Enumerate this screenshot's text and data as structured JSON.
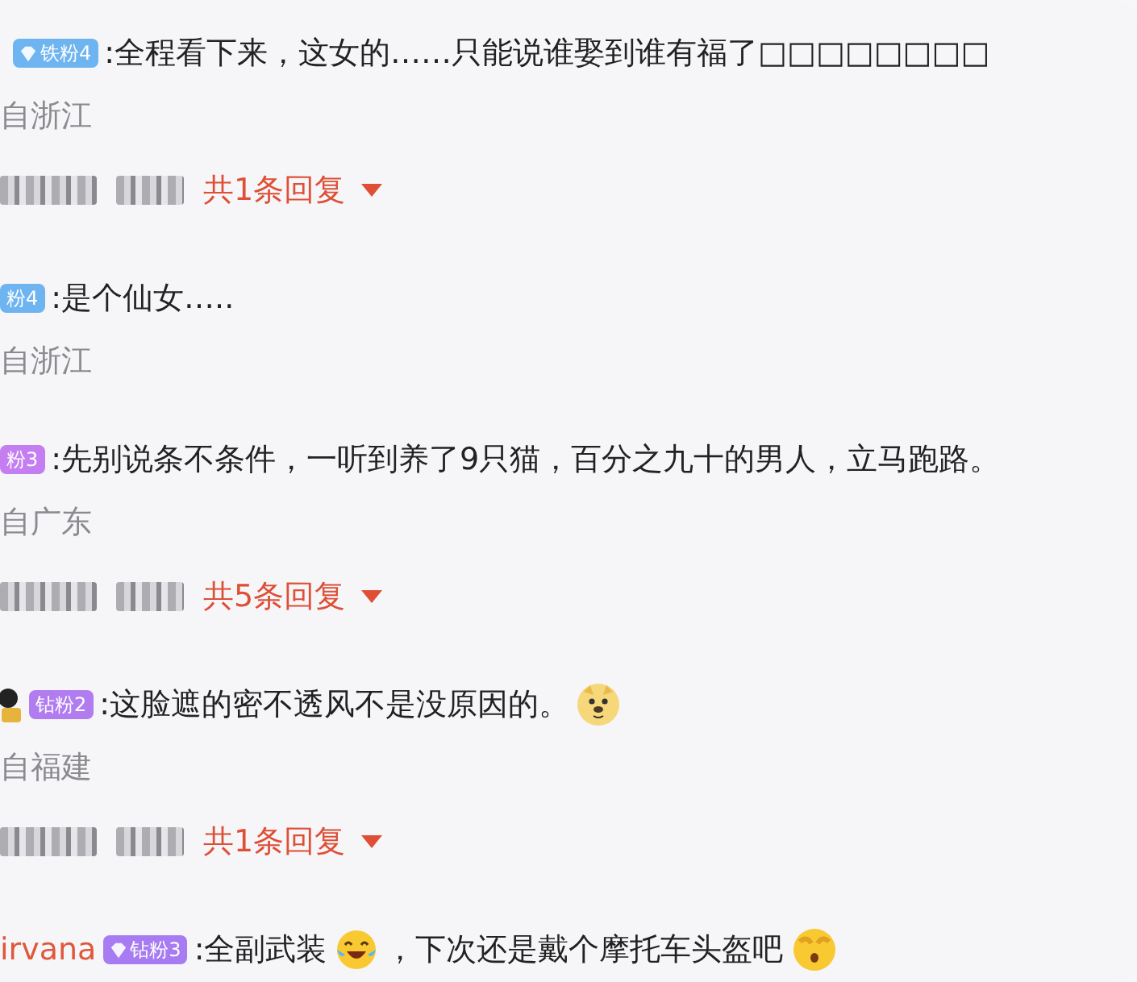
{
  "comments": [
    {
      "badge": {
        "label": "铁粉4",
        "color": "#6eb4f0",
        "kind": "gem"
      },
      "segments": [
        {
          "kind": "text",
          "text": ":全程看下来，这女的……只能说谁娶到谁有福了□□□□□□□□"
        }
      ],
      "location": "自浙江",
      "replies": "共1条回复"
    },
    {
      "badge": {
        "label": "粉4",
        "color": "#6eb4f0",
        "kind": "plain"
      },
      "segments": [
        {
          "kind": "text",
          "text": ":是个仙女….."
        }
      ],
      "location": "自浙江"
    },
    {
      "badge": {
        "label": "粉3",
        "color": "#c47ef2",
        "kind": "plain"
      },
      "segments": [
        {
          "kind": "text",
          "text": ":先别说条不条件，一听到养了9只猫，百分之九十的男人，立马跑路。"
        }
      ],
      "location": "自广东",
      "replies": "共5条回复"
    },
    {
      "badge": {
        "label": "钻粉2",
        "color": "#b07cf0",
        "kind": "avatar"
      },
      "segments": [
        {
          "kind": "text",
          "text": ":这脸遮的密不透风不是没原因的。"
        },
        {
          "kind": "doge"
        }
      ],
      "location": "自福建",
      "replies": "共1条回复"
    },
    {
      "username": "irvana",
      "badge": {
        "label": "钻粉3",
        "color": "#a77cf2",
        "kind": "gem"
      },
      "segments": [
        {
          "kind": "text",
          "text": ":全副武装"
        },
        {
          "kind": "laugh"
        },
        {
          "kind": "text",
          "text": "，下次还是戴个摩托车头盔吧"
        },
        {
          "kind": "cover"
        }
      ]
    }
  ]
}
